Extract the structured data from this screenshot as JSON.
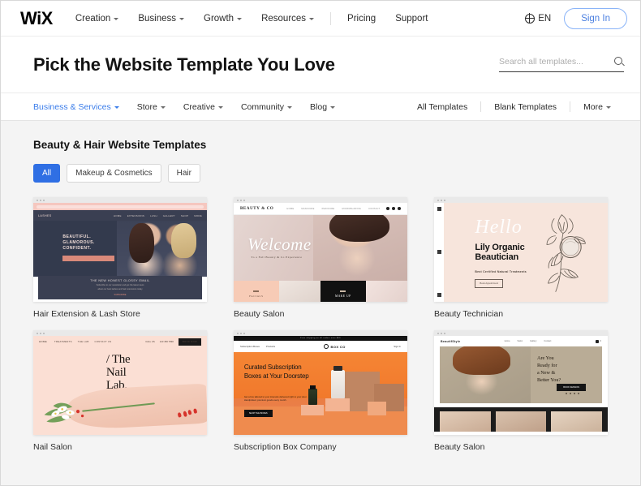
{
  "topnav": {
    "logo": "WiX",
    "items": [
      {
        "label": "Creation",
        "has_caret": true
      },
      {
        "label": "Business",
        "has_caret": true
      },
      {
        "label": "Growth",
        "has_caret": true
      },
      {
        "label": "Resources",
        "has_caret": true
      }
    ],
    "plain_items": [
      {
        "label": "Pricing"
      },
      {
        "label": "Support"
      }
    ],
    "language": "EN",
    "sign_in": "Sign In",
    "accent_color": "#4a7fe0"
  },
  "header": {
    "title": "Pick the Website Template You Love",
    "search_placeholder": "Search all templates...",
    "search_value": ""
  },
  "catbar": {
    "left": [
      {
        "label": "Business & Services",
        "active": true
      },
      {
        "label": "Store",
        "active": false
      },
      {
        "label": "Creative",
        "active": false
      },
      {
        "label": "Community",
        "active": false
      },
      {
        "label": "Blog",
        "active": false
      }
    ],
    "right": [
      {
        "label": "All Templates"
      },
      {
        "label": "Blank Templates"
      },
      {
        "label": "More"
      }
    ],
    "active_color": "#3b7dea"
  },
  "main": {
    "section_title": "Beauty & Hair Website Templates",
    "filters": [
      {
        "label": "All",
        "active": true
      },
      {
        "label": "Makeup & Cosmetics",
        "active": false
      },
      {
        "label": "Hair",
        "active": false
      }
    ],
    "filter_active_color": "#2f6fe4",
    "templates": [
      {
        "name": "Hair Extension & Lash Store",
        "brand": "LASHES",
        "menu": [
          "HOME",
          "EXTENSIONS",
          "LASH",
          "GALLERY",
          "SHOP",
          "MORE"
        ],
        "headline_1": "BEAUTIFUL.",
        "headline_2": "GLAMOROUS.",
        "headline_3": "CONFIDENT.",
        "panel_title": "THE NEW HONEST GLOSSY EMAIL",
        "panel_sub_1": "Subscribe to our newsletter and get the latest news",
        "panel_sub_2": "about our best lashes and hair extensions today",
        "panel_button": "SUBSCRIBE"
      },
      {
        "name": "Beauty Salon",
        "brand": "BEAUTY & CO",
        "menu": [
          "HOME",
          "MANICURE",
          "PEDICURE",
          "MICROBLADING",
          "CONTACT"
        ],
        "hero_script": "Welcome",
        "hero_sub": "To a Full Beauty & Co Experience",
        "tile_1": "FACIALS",
        "tile_2": "MAKE UP"
      },
      {
        "name": "Beauty Technician",
        "hero_script": "Hello",
        "headline_1": "Lily Organic",
        "headline_2": "Beautician",
        "subtext": "Best Certified Natural Treatments",
        "button": "Book Appointment"
      },
      {
        "name": "Nail Salon",
        "menu": [
          "HOME",
          "TREATMENTS",
          "THE LAB",
          "CONTACT US"
        ],
        "right_links": [
          "CALL US",
          "123 456 7890"
        ],
        "book_button": "BOOK NOW",
        "headline_1": "/ The",
        "headline_2": "Nail",
        "headline_3": "Lab."
      },
      {
        "name": "Subscription Box Company",
        "banner": "Free shipping on all orders over $50",
        "menu": [
          "Subscription Boxes",
          "Products"
        ],
        "logo": "BOX CO",
        "right_link": "Sign In",
        "headline_1": "Curated Subscription",
        "headline_2": "Boxes at Your Doorstep",
        "paragraph_1": "Get a box tailored to your interests delivered right to",
        "paragraph_2": "your door. Handpicked, premium goods every month.",
        "cta": "SHOP THE BOXES"
      },
      {
        "name": "Beauty Salon",
        "brand": "BeautifStyle",
        "menu": [
          "Home",
          "Salon",
          "Gallery",
          "Contact"
        ],
        "cart": "0",
        "headline_1": "Are You",
        "headline_2": "Ready for",
        "headline_3": "a New &",
        "headline_4": "Better You?",
        "button": "BOOK SESSION"
      }
    ]
  }
}
